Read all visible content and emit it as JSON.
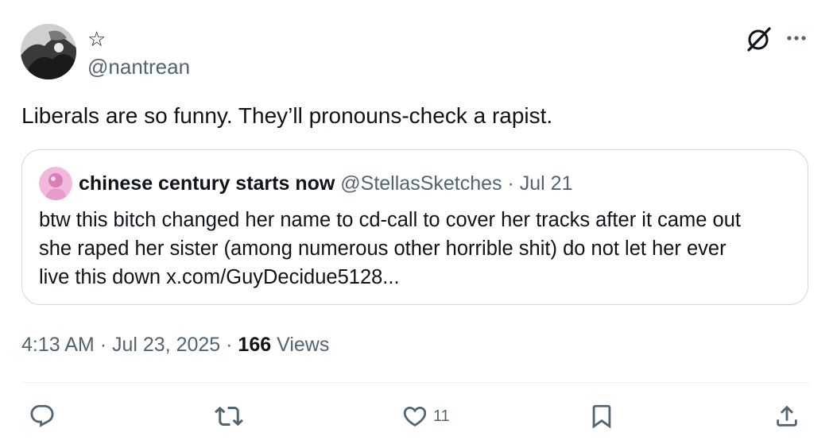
{
  "author": {
    "display_name": "☆",
    "handle": "@nantrean"
  },
  "tweet": {
    "text": "Liberals are so funny. They’ll pronouns-check a rapist."
  },
  "quote": {
    "name": "chinese century starts now",
    "handle": "@StellasSketches",
    "separator": "·",
    "date": "Jul 21",
    "lines": [
      "btw this bitch changed her name to cd-call to cover her tracks after it came out",
      "she raped her sister (among numerous other horrible shit) do not let her ever",
      "live this down x.com/GuyDecidue5128..."
    ]
  },
  "meta": {
    "time": "4:13 AM",
    "sep1": "·",
    "date": "Jul 23, 2025",
    "sep2": "·",
    "views_count": "166",
    "views_label": "Views"
  },
  "actions": {
    "reply_count": "",
    "retweet_count": "",
    "like_count": "11",
    "bookmark_count": ""
  },
  "icons": {
    "grok": "grok-icon",
    "more": "more-icon",
    "reply": "reply-icon",
    "retweet": "retweet-icon",
    "like": "heart-icon",
    "bookmark": "bookmark-icon",
    "share": "share-icon"
  },
  "colors": {
    "text": "#0f1419",
    "secondary": "#536471",
    "border": "#cfd9de"
  }
}
